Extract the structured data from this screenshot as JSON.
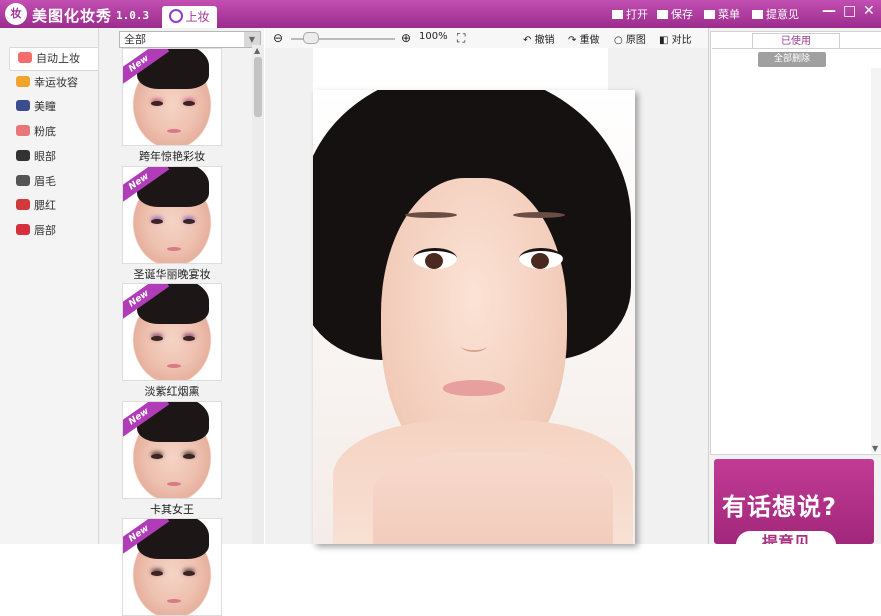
{
  "titlebar": {
    "logo_text": "妆",
    "app_name": "美图化妆秀",
    "version": "1.0.3",
    "active_tab": "上妆",
    "buttons": {
      "open": "打开",
      "save": "保存",
      "menu": "菜单",
      "feedback": "提意见"
    }
  },
  "categories": [
    {
      "label": "自动上妆",
      "icon": "heart-icon",
      "color": "#f36d6d",
      "active": true
    },
    {
      "label": "幸运妆容",
      "icon": "crown-icon",
      "color": "#f1a42b"
    },
    {
      "label": "美瞳",
      "icon": "eye-contact-icon",
      "color": "#3a4d8c"
    },
    {
      "label": "粉底",
      "icon": "foundation-icon",
      "color": "#e97777"
    },
    {
      "label": "眼部",
      "icon": "eye-icon",
      "color": "#333333"
    },
    {
      "label": "眉毛",
      "icon": "eyebrow-icon",
      "color": "#555555"
    },
    {
      "label": "腮红",
      "icon": "blush-icon",
      "color": "#d13a3a"
    },
    {
      "label": "唇部",
      "icon": "lips-icon",
      "color": "#d62f3d"
    }
  ],
  "template_filter": {
    "value": "全部"
  },
  "templates": [
    {
      "label": "跨年惊艳彩妆",
      "badge": "New",
      "eye_color": "#c14b7e"
    },
    {
      "label": "圣诞华丽晚宴妆",
      "badge": "New",
      "eye_color": "#8b5bc7"
    },
    {
      "label": "淡紫红烟熏",
      "badge": "New",
      "eye_color": "#7e3c6a"
    },
    {
      "label": "卡其女王",
      "badge": "New",
      "eye_color": "#3b2f28"
    },
    {
      "label": "",
      "badge": "New",
      "eye_color": "#4a2c3a"
    }
  ],
  "toolbar": {
    "zoom_level": "100%",
    "zoom_percent": 100,
    "undo": "撤销",
    "redo": "重做",
    "original": "原图",
    "compare": "对比"
  },
  "right_panel": {
    "used_tab": "已使用",
    "clear_all": "全部删除",
    "feedback_title": "有话想说?",
    "feedback_button": "提意见"
  },
  "colors": {
    "brand": "#a8328f",
    "titlebar_gradient": [
      "#c24fb1",
      "#9b2c8e"
    ]
  }
}
